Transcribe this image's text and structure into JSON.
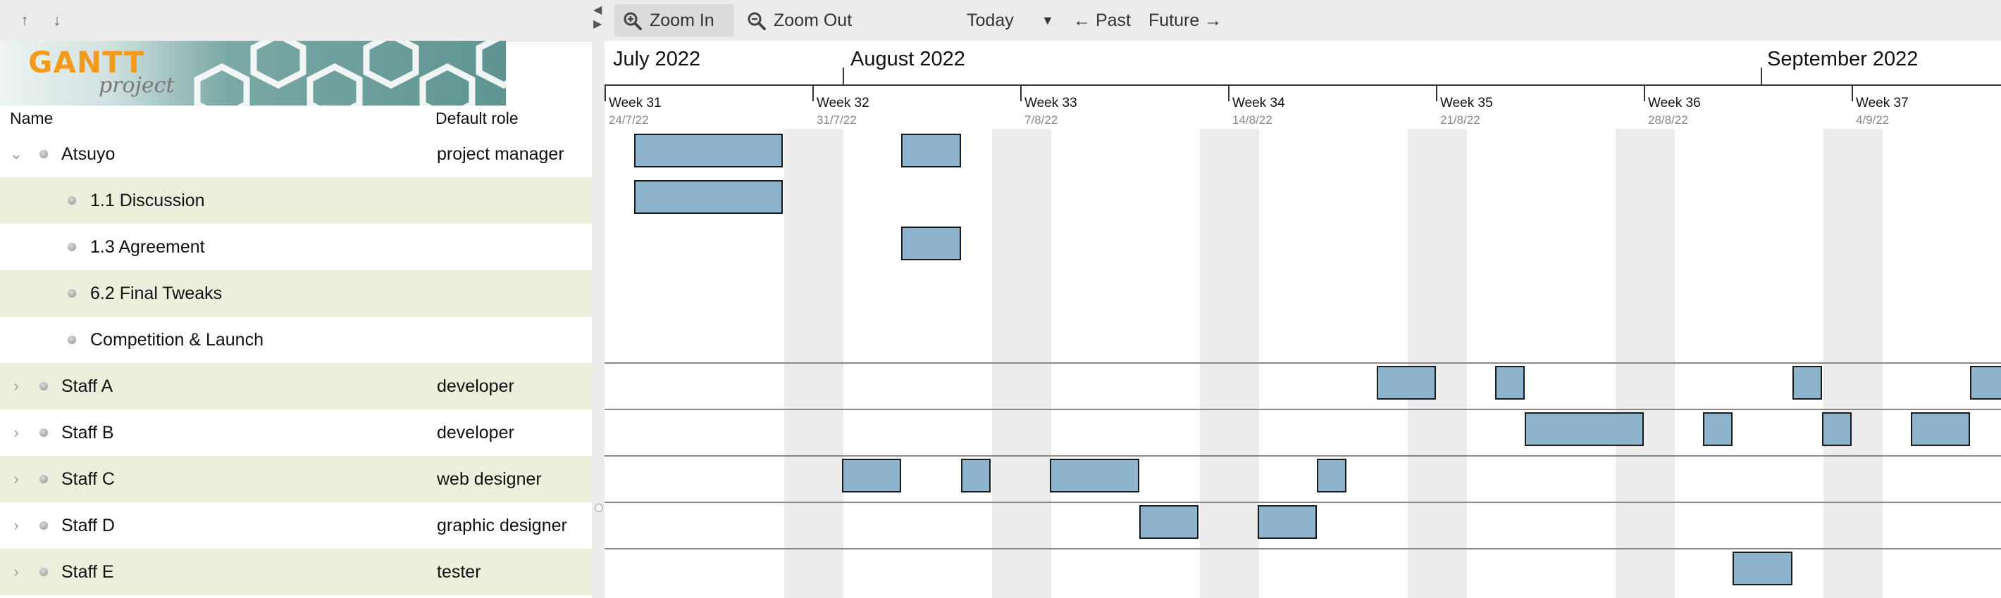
{
  "toolbar": {
    "move_up_label": "↑",
    "move_down_label": "↓",
    "zoom_in_label": "Zoom In",
    "zoom_out_label": "Zoom Out",
    "today_label": "Today",
    "past_label": "← Past",
    "future_label": "Future →",
    "collapse_label": "◀"
  },
  "logo": {
    "gantt": "GANTT",
    "project": "project"
  },
  "columns": {
    "name": "Name",
    "role": "Default role"
  },
  "rows": [
    {
      "name": "Atsuyo",
      "role": "project manager",
      "level": 0,
      "expanded": true
    },
    {
      "name": "1.1 Discussion",
      "role": "",
      "level": 1
    },
    {
      "name": "1.3 Agreement",
      "role": "",
      "level": 1
    },
    {
      "name": "6.2 Final Tweaks",
      "role": "",
      "level": 1
    },
    {
      "name": "Competition & Launch",
      "role": "",
      "level": 1
    },
    {
      "name": "Staff A",
      "role": "developer",
      "level": 0,
      "expanded": false
    },
    {
      "name": "Staff B",
      "role": "developer",
      "level": 0,
      "expanded": false
    },
    {
      "name": "Staff C",
      "role": "web designer",
      "level": 0,
      "expanded": false
    },
    {
      "name": "Staff D",
      "role": "graphic designer",
      "level": 0,
      "expanded": false
    },
    {
      "name": "Staff E",
      "role": "tester",
      "level": 0,
      "expanded": false
    }
  ],
  "timeline": {
    "months": [
      "July 2022",
      "August 2022",
      "September 2022"
    ],
    "weeks": [
      {
        "label": "Week 31",
        "date": "24/7/22"
      },
      {
        "label": "Week 32",
        "date": "31/7/22"
      },
      {
        "label": "Week 33",
        "date": "7/8/22"
      },
      {
        "label": "Week 34",
        "date": "14/8/22"
      },
      {
        "label": "Week 35",
        "date": "21/8/22"
      },
      {
        "label": "Week 36",
        "date": "28/8/22"
      },
      {
        "label": "Week 37",
        "date": "4/9/22"
      }
    ],
    "bar_color": "#8db3cd",
    "assignments": [
      {
        "row": 0,
        "bars": [
          [
            "2022-07-25",
            "2022-07-29"
          ],
          [
            "2022-08-03",
            "2022-08-04"
          ]
        ]
      },
      {
        "row": 1,
        "bars": [
          [
            "2022-07-25",
            "2022-07-29"
          ]
        ]
      },
      {
        "row": 2,
        "bars": [
          [
            "2022-08-03",
            "2022-08-04"
          ]
        ]
      },
      {
        "row": 3,
        "bars": []
      },
      {
        "row": 4,
        "bars": []
      },
      {
        "row": 5,
        "bars": [
          [
            "2022-08-19",
            "2022-08-20"
          ],
          [
            "2022-08-23",
            "2022-08-23"
          ],
          [
            "2022-09-02",
            "2022-09-02"
          ],
          [
            "2022-09-08",
            "2022-09-09"
          ]
        ]
      },
      {
        "row": 6,
        "bars": [
          [
            "2022-08-24",
            "2022-08-27"
          ],
          [
            "2022-08-30",
            "2022-08-30"
          ],
          [
            "2022-09-03",
            "2022-09-03"
          ],
          [
            "2022-09-06",
            "2022-09-07"
          ]
        ]
      },
      {
        "row": 7,
        "bars": [
          [
            "2022-08-01",
            "2022-08-02"
          ],
          [
            "2022-08-05",
            "2022-08-05"
          ],
          [
            "2022-08-08",
            "2022-08-10"
          ],
          [
            "2022-08-17",
            "2022-08-17"
          ]
        ]
      },
      {
        "row": 8,
        "bars": [
          [
            "2022-08-11",
            "2022-08-12"
          ],
          [
            "2022-08-15",
            "2022-08-16"
          ]
        ]
      },
      {
        "row": 9,
        "bars": [
          [
            "2022-08-31",
            "2022-09-01"
          ]
        ]
      }
    ]
  }
}
